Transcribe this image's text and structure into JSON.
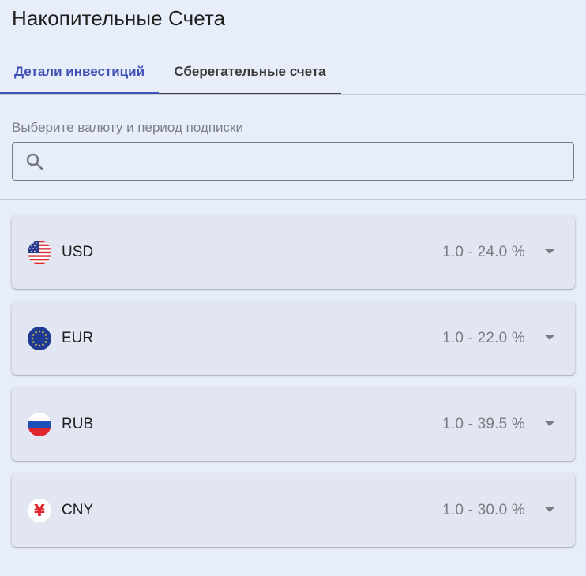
{
  "page": {
    "title": "Накопительные Счета"
  },
  "tabs": [
    {
      "label": "Детали инвестиций",
      "active": true
    },
    {
      "label": "Сберегательные счета",
      "active": false
    }
  ],
  "search": {
    "label": "Выберите валюту и период подписки",
    "value": "",
    "placeholder": "",
    "icon": "search-icon"
  },
  "currencies": [
    {
      "code": "USD",
      "rate": "1.0 - 24.0 %",
      "flag": "us-flag-icon"
    },
    {
      "code": "EUR",
      "rate": "1.0 - 22.0 %",
      "flag": "eu-flag-icon"
    },
    {
      "code": "RUB",
      "rate": "1.0 - 39.5 %",
      "flag": "ru-flag-icon"
    },
    {
      "code": "CNY",
      "rate": "1.0 - 30.0 %",
      "flag": "cny-yuan-icon",
      "symbol": "¥"
    }
  ],
  "colors": {
    "background": "#e8eef9",
    "accent": "#3f51b5",
    "card": "#e1e6f2",
    "muted_text": "#7a7c82"
  }
}
